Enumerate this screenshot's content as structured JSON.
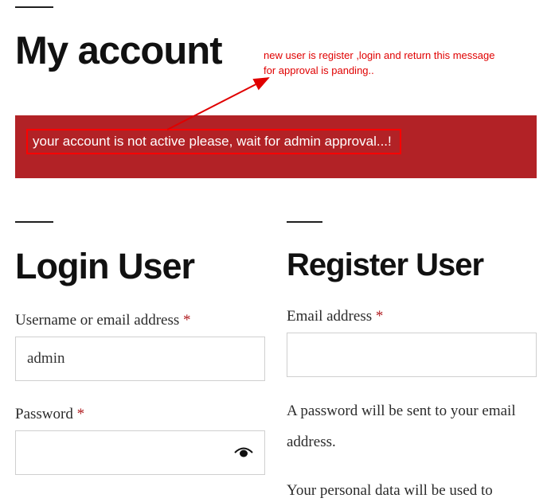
{
  "page_title": "My account",
  "annotation": {
    "text": "new user is register ,login and return this message for approval is panding..",
    "color": "#e00000"
  },
  "notice": {
    "message": "your account is not active please, wait for admin approval...!",
    "background": "#b22226",
    "highlight_border": "#ff0000"
  },
  "login": {
    "heading": "Login User",
    "username_label": "Username or email address",
    "username_value": "admin",
    "password_label": "Password",
    "password_value": "",
    "required_mark": "*",
    "show_password_icon": "eye-icon"
  },
  "register": {
    "heading": "Register User",
    "email_label": "Email address",
    "email_value": "",
    "required_mark": "*",
    "password_note": "A password will be sent to your email address.",
    "privacy_text": "Your personal data will be used to"
  }
}
